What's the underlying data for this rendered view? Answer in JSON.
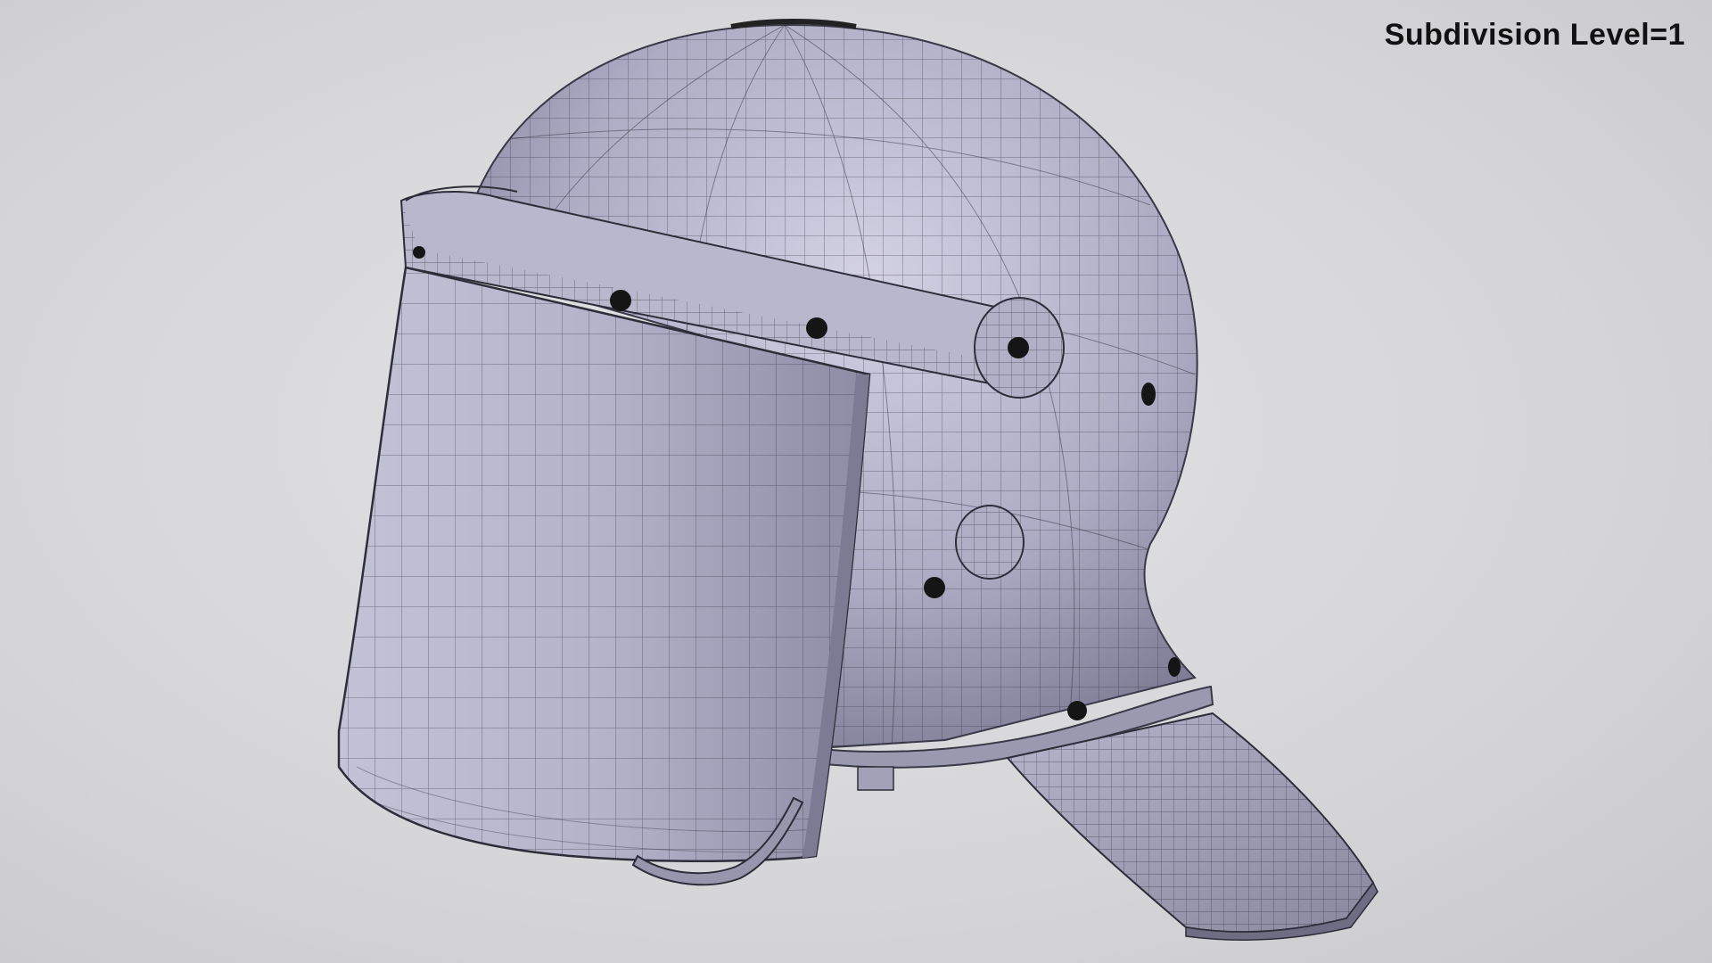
{
  "overlay": {
    "label": "Subdivision Level=1"
  },
  "palette": {
    "background": "#d7d7d9",
    "shell": "#a8a6bd",
    "shell_light": "#cfcde0",
    "shell_dark": "#7c7a92",
    "wire": "#2a2a33",
    "rivet": "#151515"
  },
  "icons": [
    "helmet-render"
  ]
}
